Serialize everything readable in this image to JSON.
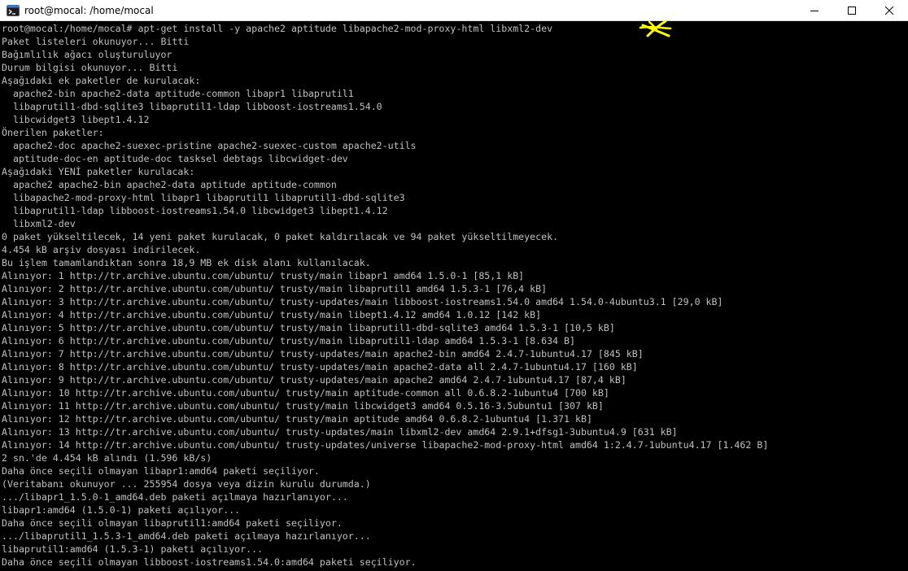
{
  "window": {
    "title": "root@mocal: /home/mocal",
    "icon": "terminal-icon"
  },
  "colors": {
    "terminal_bg": "#000000",
    "terminal_fg": "#c0c0c0",
    "annotation_mark": "#ffff00"
  },
  "annotation": {
    "icon": "yellow-scribble-mark-icon"
  },
  "terminal": {
    "lines": [
      "root@mocal:/home/mocal# apt-get install -y apache2 aptitude libapache2-mod-proxy-html libxml2-dev",
      "Paket listeleri okunuyor... Bitti",
      "Bağımlılık ağacı oluşturuluyor",
      "Durum bilgisi okunuyor... Bitti",
      "Aşağıdaki ek paketler de kurulacak:",
      "  apache2-bin apache2-data aptitude-common libapr1 libaprutil1",
      "  libaprutil1-dbd-sqlite3 libaprutil1-ldap libboost-iostreams1.54.0",
      "  libcwidget3 libept1.4.12",
      "Önerilen paketler:",
      "  apache2-doc apache2-suexec-pristine apache2-suexec-custom apache2-utils",
      "  aptitude-doc-en aptitude-doc tasksel debtags libcwidget-dev",
      "Aşağıdaki YENİ paketler kurulacak:",
      "  apache2 apache2-bin apache2-data aptitude aptitude-common",
      "  libapache2-mod-proxy-html libapr1 libaprutil1 libaprutil1-dbd-sqlite3",
      "  libaprutil1-ldap libboost-iostreams1.54.0 libcwidget3 libept1.4.12",
      "  libxml2-dev",
      "0 paket yükseltilecek, 14 yeni paket kurulacak, 0 paket kaldırılacak ve 94 paket yükseltilmeyecek.",
      "4.454 kB arşiv dosyası indirilecek.",
      "Bu işlem tamamlandıktan sonra 18,9 MB ek disk alanı kullanılacak.",
      "Alınıyor: 1 http://tr.archive.ubuntu.com/ubuntu/ trusty/main libapr1 amd64 1.5.0-1 [85,1 kB]",
      "Alınıyor: 2 http://tr.archive.ubuntu.com/ubuntu/ trusty/main libaprutil1 amd64 1.5.3-1 [76,4 kB]",
      "Alınıyor: 3 http://tr.archive.ubuntu.com/ubuntu/ trusty-updates/main libboost-iostreams1.54.0 amd64 1.54.0-4ubuntu3.1 [29,0 kB]",
      "Alınıyor: 4 http://tr.archive.ubuntu.com/ubuntu/ trusty/main libept1.4.12 amd64 1.0.12 [142 kB]",
      "Alınıyor: 5 http://tr.archive.ubuntu.com/ubuntu/ trusty/main libaprutil1-dbd-sqlite3 amd64 1.5.3-1 [10,5 kB]",
      "Alınıyor: 6 http://tr.archive.ubuntu.com/ubuntu/ trusty/main libaprutil1-ldap amd64 1.5.3-1 [8.634 B]",
      "Alınıyor: 7 http://tr.archive.ubuntu.com/ubuntu/ trusty-updates/main apache2-bin amd64 2.4.7-1ubuntu4.17 [845 kB]",
      "Alınıyor: 8 http://tr.archive.ubuntu.com/ubuntu/ trusty-updates/main apache2-data all 2.4.7-1ubuntu4.17 [160 kB]",
      "Alınıyor: 9 http://tr.archive.ubuntu.com/ubuntu/ trusty-updates/main apache2 amd64 2.4.7-1ubuntu4.17 [87,4 kB]",
      "Alınıyor: 10 http://tr.archive.ubuntu.com/ubuntu/ trusty/main aptitude-common all 0.6.8.2-1ubuntu4 [700 kB]",
      "Alınıyor: 11 http://tr.archive.ubuntu.com/ubuntu/ trusty/main libcwidget3 amd64 0.5.16-3.5ubuntu1 [307 kB]",
      "Alınıyor: 12 http://tr.archive.ubuntu.com/ubuntu/ trusty/main aptitude amd64 0.6.8.2-1ubuntu4 [1.371 kB]",
      "Alınıyor: 13 http://tr.archive.ubuntu.com/ubuntu/ trusty-updates/main libxml2-dev amd64 2.9.1+dfsg1-3ubuntu4.9 [631 kB]",
      "Alınıyor: 14 http://tr.archive.ubuntu.com/ubuntu/ trusty-updates/universe libapache2-mod-proxy-html amd64 1:2.4.7-1ubuntu4.17 [1.462 B]",
      "2 sn.'de 4.454 kB alındı (1.596 kB/s)",
      "Daha önce seçili olmayan libapr1:amd64 paketi seçiliyor.",
      "(Veritabanı okunuyor ... 255954 dosya veya dizin kurulu durumda.)",
      ".../libapr1_1.5.0-1_amd64.deb paketi açılmaya hazırlanıyor...",
      "libapr1:amd64 (1.5.0-1) paketi açılıyor...",
      "Daha önce seçili olmayan libaprutil1:amd64 paketi seçiliyor.",
      ".../libaprutil1_1.5.3-1_amd64.deb paketi açılmaya hazırlanıyor...",
      "libaprutil1:amd64 (1.5.3-1) paketi açılıyor...",
      "Daha önce seçili olmayan libboost-iostreams1.54.0:amd64 paketi seçiliyor."
    ]
  },
  "controls": {
    "minimize": "minimize-icon",
    "maximize": "maximize-icon",
    "close": "close-icon"
  }
}
